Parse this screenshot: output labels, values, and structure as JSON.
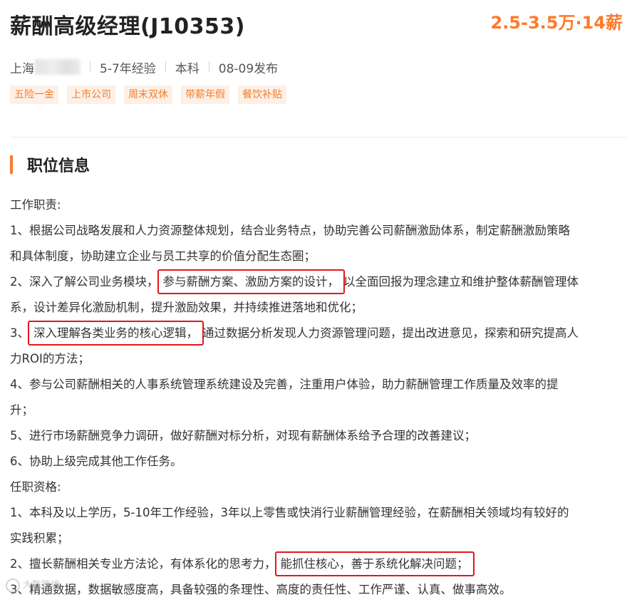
{
  "job": {
    "title": "薪酬高级经理(J10353)",
    "salary": "2.5-3.5万·14薪"
  },
  "meta": {
    "location": "上海",
    "experience": "5-7年经验",
    "education": "本科",
    "posted": "08-09发布"
  },
  "tags": [
    "五险一金",
    "上市公司",
    "周末双休",
    "带薪年假",
    "餐饮补贴"
  ],
  "section": {
    "title": "职位信息"
  },
  "description": {
    "lines": [
      {
        "parts": [
          {
            "text": "工作职责:",
            "hl": false
          }
        ]
      },
      {
        "parts": [
          {
            "text": "1、根据公司战略发展和人力资源整体规划，结合业务特点，协助完善公司薪酬激励体系，制定薪酬激励策略",
            "hl": false
          }
        ]
      },
      {
        "parts": [
          {
            "text": "和具体制度，协助建立企业与员工共享的价值分配生态圈；",
            "hl": false
          }
        ]
      },
      {
        "parts": [
          {
            "text": "2、深入了解公司业务模块，",
            "hl": false
          },
          {
            "text": "参与薪酬方案、激励方案的设计，",
            "hl": true
          },
          {
            "text": "以全面回报为理念建立和维护整体薪酬管理体",
            "hl": false
          }
        ]
      },
      {
        "parts": [
          {
            "text": "系，设计差异化激励机制，提升激励效果，并持续推进落地和优化；",
            "hl": false
          }
        ]
      },
      {
        "parts": [
          {
            "text": "3、",
            "hl": false
          },
          {
            "text": "深入理解各类业务的核心逻辑，",
            "hl": true
          },
          {
            "text": "通过数据分析发现人力资源管理问题，提出改进意见，探索和研究提高人",
            "hl": false
          }
        ]
      },
      {
        "parts": [
          {
            "text": "力ROI的方法；",
            "hl": false
          }
        ]
      },
      {
        "parts": [
          {
            "text": "4、参与公司薪酬相关的人事系统管理系统建设及完善，注重用户体验，助力薪酬管理工作质量及效率的提",
            "hl": false
          }
        ]
      },
      {
        "parts": [
          {
            "text": "升；",
            "hl": false
          }
        ]
      },
      {
        "parts": [
          {
            "text": "5、进行市场薪酬竞争力调研，做好薪酬对标分析，对现有薪酬体系给予合理的改善建议；",
            "hl": false
          }
        ]
      },
      {
        "parts": [
          {
            "text": "6、协助上级完成其他工作任务。",
            "hl": false
          }
        ]
      },
      {
        "parts": [
          {
            "text": "任职资格:",
            "hl": false
          }
        ]
      },
      {
        "parts": [
          {
            "text": "1、本科及以上学历，5-10年工作经验，3年以上零售或快消行业薪酬管理经验，在薪酬相关领域均有较好的",
            "hl": false
          }
        ]
      },
      {
        "parts": [
          {
            "text": "实践积累；",
            "hl": false
          }
        ]
      },
      {
        "parts": [
          {
            "text": "2、擅长薪酬相关专业方法论，有体系化的思考力，",
            "hl": false
          },
          {
            "text": "能抓住核心，善于系统化解决问题；",
            "hl": true
          }
        ]
      },
      {
        "parts": [
          {
            "text": "3、精通数据，数据敏感度高，具备较强的条理性、高度的责任性、工作严谨、认真、做事高效。",
            "hl": false
          }
        ]
      }
    ]
  },
  "watermark": {
    "text": "大数跨境"
  }
}
